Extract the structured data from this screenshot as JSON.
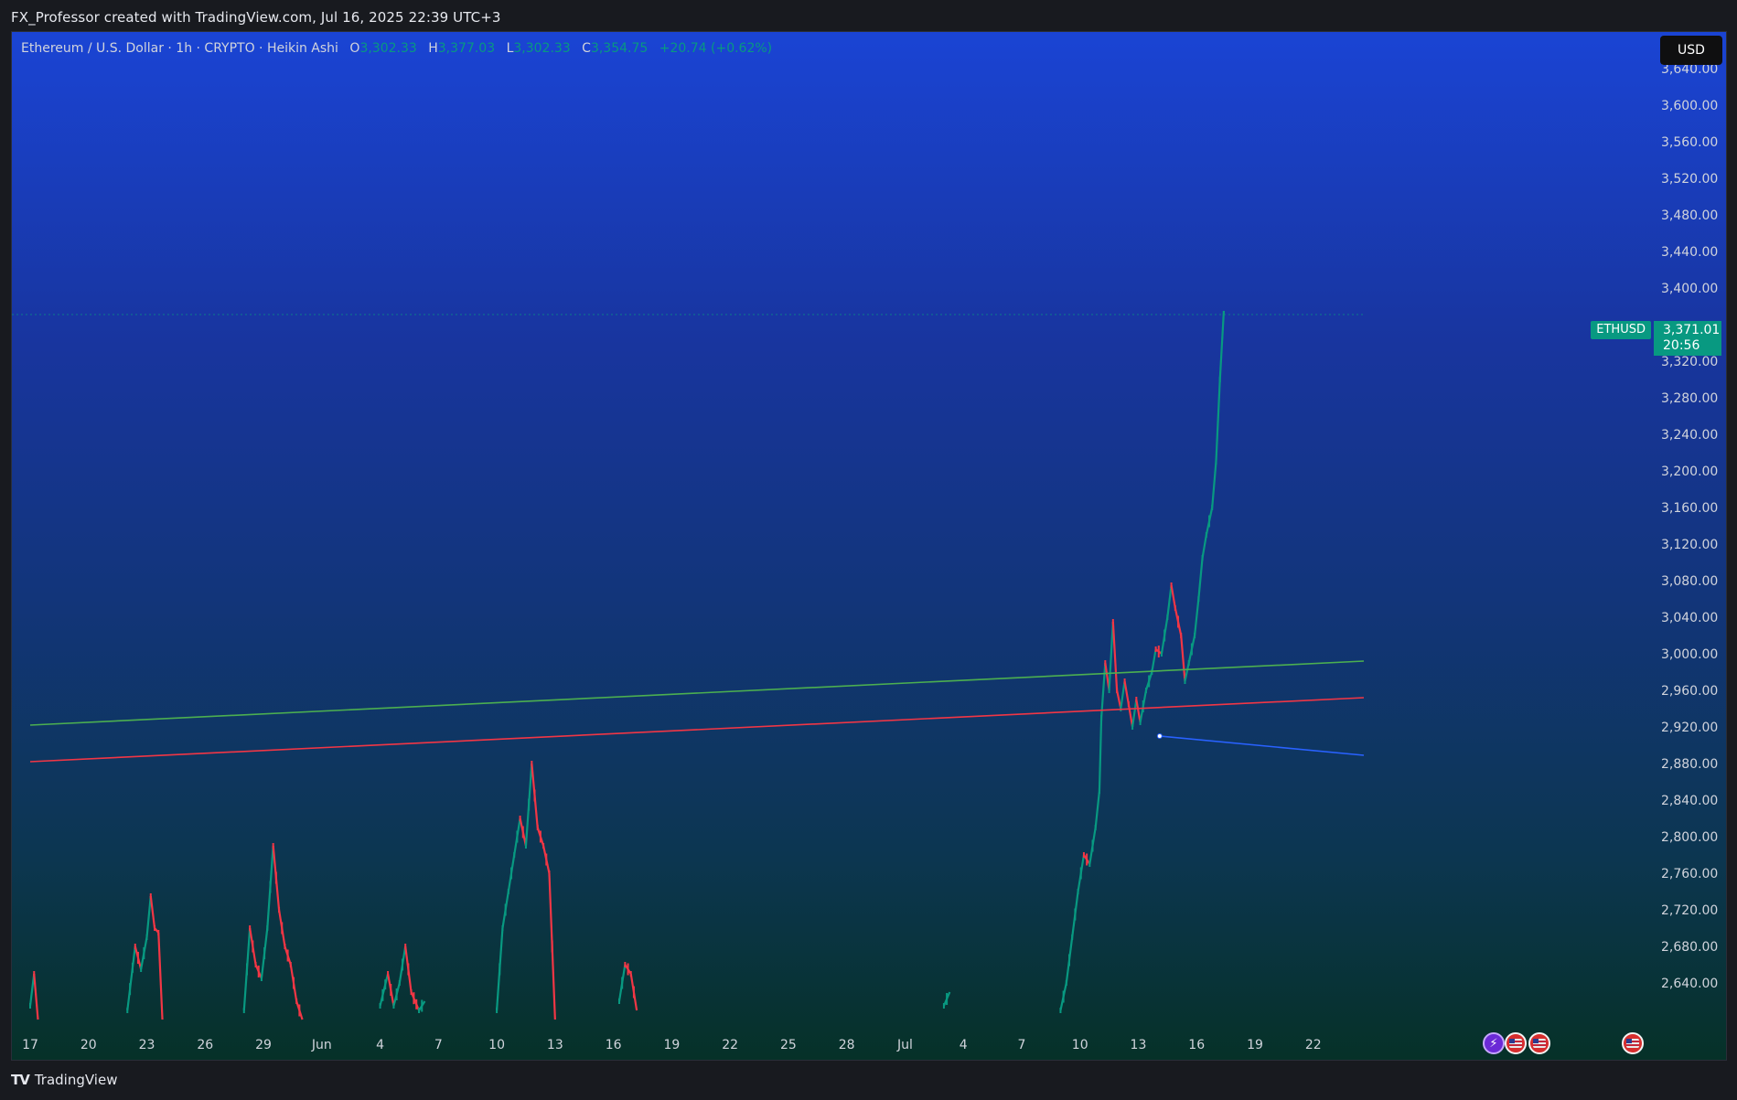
{
  "header": {
    "attribution": "FX_Professor created with TradingView.com, Jul 16, 2025 22:39 UTC+3"
  },
  "legend": {
    "title": "Ethereum / U.S. Dollar · 1h · CRYPTO · Heikin Ashi",
    "o_label": "O",
    "o_value": "3,302.33",
    "h_label": "H",
    "h_value": "3,377.03",
    "l_label": "L",
    "l_value": "3,302.33",
    "c_label": "C",
    "c_value": "3,354.75",
    "change": "+20.74 (+0.62%)"
  },
  "currency_button": "USD",
  "price_tag": {
    "symbol": "ETHUSD",
    "price": "3,371.01",
    "countdown": "20:56"
  },
  "footer": {
    "brand": "TradingView",
    "logo_glyph": "TV"
  },
  "colors": {
    "up": "#089981",
    "down": "#f23645",
    "green_line": "#4caf50",
    "red_line": "#f23645",
    "blue_line": "#2962ff"
  },
  "events": [
    {
      "name": "bolt-icon",
      "glyph": "⚡"
    },
    {
      "name": "us-flag-icon"
    },
    {
      "name": "us-flag-icon"
    },
    {
      "name": "us-flag-icon"
    }
  ],
  "chart_data": {
    "type": "candlestick",
    "style": "Heikin Ashi",
    "symbol": "ETHUSD",
    "interval": "1h",
    "ylim": [
      2600,
      3680
    ],
    "y_ticks": [
      2640,
      2680,
      2720,
      2760,
      2800,
      2840,
      2880,
      2920,
      2960,
      3000,
      3040,
      3080,
      3120,
      3160,
      3200,
      3240,
      3280,
      3320,
      3400,
      3440,
      3480,
      3520,
      3560,
      3600,
      3640
    ],
    "y_tick_labels": [
      "2,640.00",
      "2,680.00",
      "2,720.00",
      "2,760.00",
      "2,800.00",
      "2,840.00",
      "2,880.00",
      "2,920.00",
      "2,960.00",
      "3,000.00",
      "3,040.00",
      "3,080.00",
      "3,120.00",
      "3,160.00",
      "3,200.00",
      "3,240.00",
      "3,280.00",
      "3,320.00",
      "3,400.00",
      "3,440.00",
      "3,480.00",
      "3,520.00",
      "3,560.00",
      "3,600.00",
      "3,640.00"
    ],
    "x_range_days": [
      0,
      68.6
    ],
    "x_ticks": [
      {
        "day": 0,
        "label": "17"
      },
      {
        "day": 3,
        "label": "20"
      },
      {
        "day": 6,
        "label": "23"
      },
      {
        "day": 9,
        "label": "26"
      },
      {
        "day": 12,
        "label": "29"
      },
      {
        "day": 15,
        "label": "Jun"
      },
      {
        "day": 18,
        "label": "4"
      },
      {
        "day": 21,
        "label": "7"
      },
      {
        "day": 24,
        "label": "10"
      },
      {
        "day": 27,
        "label": "13"
      },
      {
        "day": 30,
        "label": "16"
      },
      {
        "day": 33,
        "label": "19"
      },
      {
        "day": 36,
        "label": "22"
      },
      {
        "day": 39,
        "label": "25"
      },
      {
        "day": 42,
        "label": "28"
      },
      {
        "day": 45,
        "label": "Jul"
      },
      {
        "day": 48,
        "label": "4"
      },
      {
        "day": 51,
        "label": "7"
      },
      {
        "day": 54,
        "label": "10"
      },
      {
        "day": 57,
        "label": "13"
      },
      {
        "day": 60,
        "label": "16"
      },
      {
        "day": 63,
        "label": "19"
      },
      {
        "day": 66,
        "label": "22"
      }
    ],
    "last_price": 3371.01,
    "trendlines": [
      {
        "name": "green-trendline",
        "color": "#4caf50",
        "points": [
          [
            0,
            2922
          ],
          [
            68.6,
            2992
          ]
        ]
      },
      {
        "name": "red-trendline",
        "color": "#f23645",
        "points": [
          [
            0,
            2882
          ],
          [
            68.6,
            2952
          ]
        ]
      },
      {
        "name": "blue-trendline",
        "color": "#2962ff",
        "points": [
          [
            58.1,
            2910
          ],
          [
            68.6,
            2889
          ]
        ]
      }
    ],
    "series_points": [
      [
        0,
        2615
      ],
      [
        0.2,
        2650
      ],
      [
        0.4,
        2600
      ],
      [
        5,
        2610
      ],
      [
        5.4,
        2680
      ],
      [
        5.7,
        2655
      ],
      [
        6,
        2690
      ],
      [
        6.2,
        2735
      ],
      [
        6.4,
        2700
      ],
      [
        6.6,
        2695
      ],
      [
        6.8,
        2600
      ],
      [
        11,
        2610
      ],
      [
        11.3,
        2700
      ],
      [
        11.6,
        2660
      ],
      [
        11.9,
        2645
      ],
      [
        12.2,
        2700
      ],
      [
        12.5,
        2790
      ],
      [
        12.8,
        2720
      ],
      [
        13.1,
        2680
      ],
      [
        13.4,
        2660
      ],
      [
        13.7,
        2620
      ],
      [
        14,
        2600
      ],
      [
        18,
        2615
      ],
      [
        18.4,
        2650
      ],
      [
        18.7,
        2615
      ],
      [
        19,
        2640
      ],
      [
        19.3,
        2680
      ],
      [
        19.6,
        2630
      ],
      [
        20,
        2610
      ],
      [
        20.3,
        2620
      ],
      [
        24,
        2610
      ],
      [
        24.3,
        2700
      ],
      [
        24.6,
        2740
      ],
      [
        24.9,
        2780
      ],
      [
        25.2,
        2820
      ],
      [
        25.5,
        2790
      ],
      [
        25.8,
        2880
      ],
      [
        26.1,
        2810
      ],
      [
        26.4,
        2790
      ],
      [
        26.7,
        2760
      ],
      [
        27,
        2600
      ],
      [
        30.3,
        2620
      ],
      [
        30.6,
        2660
      ],
      [
        30.9,
        2650
      ],
      [
        31.2,
        2610
      ],
      [
        47,
        2615
      ],
      [
        47.3,
        2630
      ],
      [
        50.5,
        2605
      ],
      [
        53,
        2610
      ],
      [
        53.3,
        2640
      ],
      [
        53.6,
        2690
      ],
      [
        53.9,
        2740
      ],
      [
        54.2,
        2780
      ],
      [
        54.5,
        2770
      ],
      [
        54.8,
        2810
      ],
      [
        55,
        2850
      ],
      [
        55.1,
        2930
      ],
      [
        55.3,
        2990
      ],
      [
        55.5,
        2960
      ],
      [
        55.7,
        3035
      ],
      [
        55.9,
        2960
      ],
      [
        56.1,
        2940
      ],
      [
        56.3,
        2970
      ],
      [
        56.5,
        2945
      ],
      [
        56.7,
        2920
      ],
      [
        56.9,
        2950
      ],
      [
        57.1,
        2925
      ],
      [
        57.4,
        2960
      ],
      [
        57.7,
        2980
      ],
      [
        57.9,
        3005
      ],
      [
        58.2,
        3000
      ],
      [
        58.5,
        3040
      ],
      [
        58.7,
        3075
      ],
      [
        58.9,
        3050
      ],
      [
        59.2,
        3020
      ],
      [
        59.4,
        2970
      ],
      [
        59.6,
        2990
      ],
      [
        59.9,
        3020
      ],
      [
        60.1,
        3060
      ],
      [
        60.3,
        3105
      ],
      [
        60.5,
        3130
      ],
      [
        60.8,
        3160
      ],
      [
        61,
        3210
      ],
      [
        61.2,
        3300
      ],
      [
        61.4,
        3375
      ]
    ]
  }
}
